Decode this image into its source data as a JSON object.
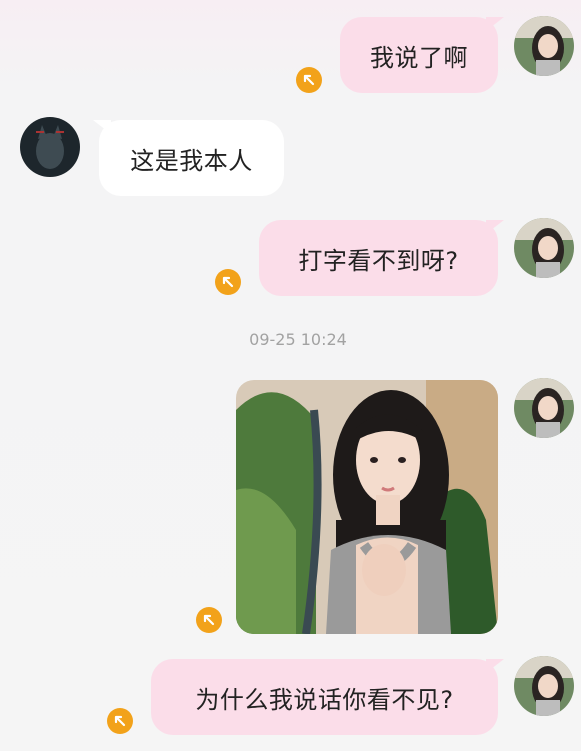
{
  "chat": {
    "messages": [
      {
        "sender": "self",
        "type": "text",
        "text": "我说了啊"
      },
      {
        "sender": "other",
        "type": "text",
        "text": "这是我本人"
      },
      {
        "sender": "self",
        "type": "text",
        "text": "打字看不到呀?"
      },
      {
        "sender": "system",
        "type": "timestamp",
        "text": "09-25 10:24"
      },
      {
        "sender": "self",
        "type": "image",
        "description": "selfie photo"
      },
      {
        "sender": "self",
        "type": "text",
        "text": "为什么我说话你看不见?"
      }
    ],
    "icons": {
      "self_avatar": "girl-avatar-icon",
      "other_avatar": "wolf-avatar-icon",
      "status": "arrow-up-left-icon"
    },
    "colors": {
      "self_bubble": "#fbdde9",
      "other_bubble": "#ffffff",
      "status_badge": "#f2a21a",
      "timestamp_text": "#a2a2a2"
    }
  }
}
